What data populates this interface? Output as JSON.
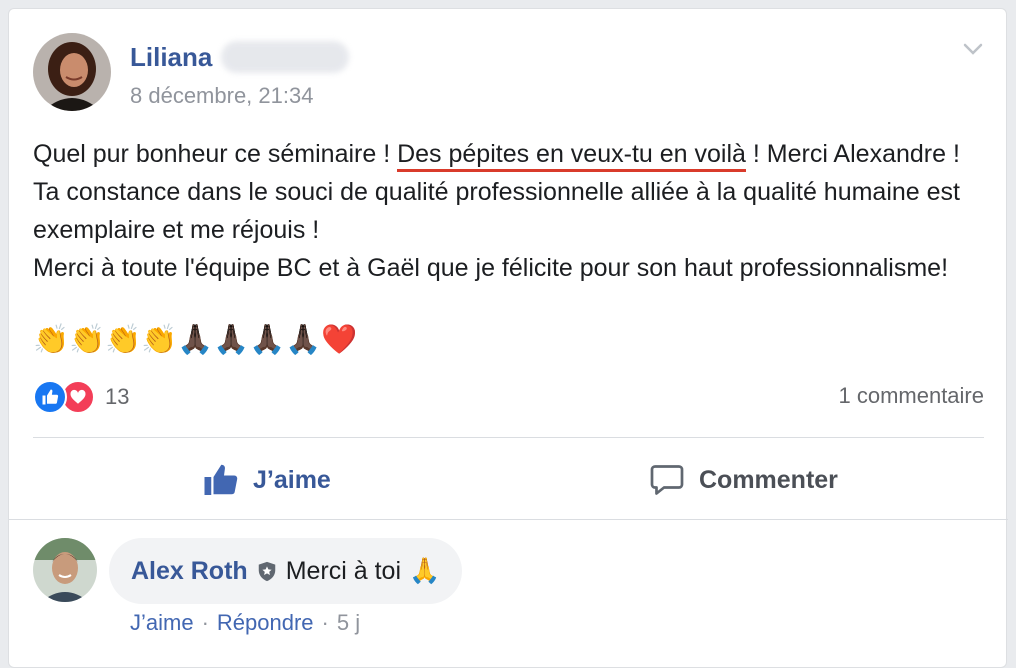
{
  "post": {
    "author_name": "Liliana",
    "timestamp": "8 décembre, 21:34",
    "text": {
      "part1": "Quel pur bonheur ce séminaire ! ",
      "highlight": "Des pépites en veux-tu en voilà",
      "part2": " ! Merci Alexandre ! Ta constance dans le souci de qualité professionnelle alliée à la qualité humaine est exemplaire et me réjouis !",
      "line2": "Merci à toute l'équipe BC et à Gaël que je félicite pour son haut professionnalisme!"
    },
    "emojis": [
      "👏",
      "👏",
      "👏",
      "👏",
      "🙏🏿",
      "🙏🏿",
      "🙏🏿",
      "🙏🏿",
      "❤️"
    ],
    "reaction_count": "13",
    "comment_count": "1 commentaire"
  },
  "actions": {
    "like_label": "J’aime",
    "comment_label": "Commenter"
  },
  "comment": {
    "author_name": "Alex Roth",
    "text": "Merci à toi",
    "emoji": "🙏",
    "like_label": "J’aime",
    "reply_label": "Répondre",
    "age": "5 j",
    "separator": "·"
  },
  "colors": {
    "link_blue": "#385898",
    "highlight_underline": "#d93b2b",
    "like_blue": "#1877f2",
    "love_red": "#f33e58"
  }
}
